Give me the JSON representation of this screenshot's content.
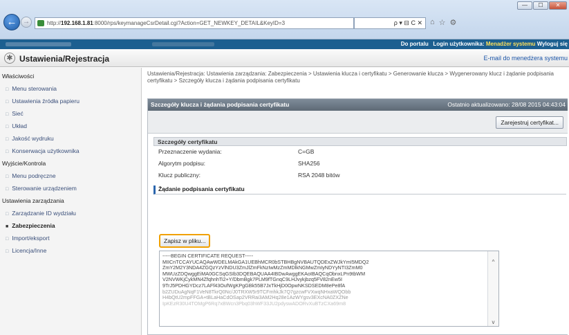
{
  "browser": {
    "address_prefix": "http://",
    "address_host": "192.168.1.81",
    "address_path": ":8000/rps/keymanageCsrDetail.cgi?Action=GET_NEWKEY_DETAIL&KeyID=3",
    "search_glyphs": "ρ ▾ ⊟ C ✕",
    "window_min": "—",
    "window_max": "☐",
    "window_close": "✕",
    "back_glyph": "←",
    "fwd_glyph": "→",
    "icons": [
      "home-icon",
      "star-icon",
      "gear-icon"
    ]
  },
  "portal": {
    "link_portal": "Do portalu",
    "login_user": "Login użytkownika:",
    "user_name": "Menadżer systemu",
    "logout": "Wyloguj się"
  },
  "header": {
    "title": "Ustawienia/Rejestracja",
    "mail_link": "E-mail do menedżera systemu"
  },
  "sidebar": {
    "section1": "Właściwości",
    "items1": [
      "Menu sterowania",
      "Ustawienia źródła papieru",
      "Sieć",
      "Układ",
      "Jakość wydruku",
      "Konserwacja użytkownika"
    ],
    "section2": "Wyjście/Kontrola",
    "items2": [
      "Menu podręczne",
      "Sterowanie urządzeniem"
    ],
    "section3": "Ustawienia zarządzania",
    "items3": [
      "Zarządzanie ID wydziału",
      "Zabezpieczenia",
      "Import/eksport",
      "Licencja/Inne"
    ],
    "active": "Zabezpieczenia"
  },
  "breadcrumb": "Ustawienia/Rejestracja: Ustawienia zarządzania: Zabezpieczenia > Ustawienia klucza i certyfikatu > Generowanie klucza > Wygenerowany klucz i żądanie podpisania certyfikatu > Szczegóły klucza i żądania podpisania certyfikatu",
  "panel": {
    "title": "Szczegóły klucza i żądania podpisania certyfikatu",
    "updated": "Ostatnio aktualizowano: 28/08 2015 04:43:04",
    "register_button": "Zarejestruj certyfikat..."
  },
  "details": {
    "section_title": "Szczegóły certyfikatu",
    "rows": [
      {
        "key": "Przeznaczenie wydania:",
        "value": "C=GB"
      },
      {
        "key": "Algorytm podpisu:",
        "value": "SHA256"
      },
      {
        "key": "Klucz publiczny:",
        "value": "RSA 2048 bitów"
      }
    ]
  },
  "csr": {
    "section_title": "Żądanie podpisania certyfikatu",
    "save_button": "Zapisz w pliku...",
    "lines": [
      "-----BEGIN CERTIFICATE REQUEST-----",
      "MIICnTCCAYUCAQAwWDELMAkGA1UEBhMCR0bSTBHBgNVBAUTQDExZWJkYmI5MDQ2",
      "ZmY2M2Y3NDA4ZGQzYzVlNDU3ZmJlZmFkNzIwMzZmMDlkNGMwZmIyNDYyNTI3ZmM0",
      "MWUzZDQwggEiMA0GCSqGSIb3DQEBAQUAA4IBDwAwggEKAoIBAQCqObnxLPn9tbWM",
      "V2NVWKjCykMN4ZfqhnhTi2+Y/DbmBgk7PLM9fTGnqC9LHJvykjbzq5FV82nEw5I",
      "9TrJ5PDHGYDcz7LAFf43OufWgKPgGBk55B7JxTkHjD0OpwNKSDSEDM8ePe8fA",
      "b2ZUDuAgNqF1VeN8TkrQ0Nc/J0TRXW5r9TCFmhkJk7Q7gzcwFVXwqNHxaWQObb",
      "H4bQtU2mpFFGA+tBLaHaCdOSap2VRRai3AM2Hq28e1AzWYgsv3EXcNA0ZXZNe",
      "IpKEzR30U4TOMgP6Rq7xBWcn3Pbq03hWF33JU2pdyswADORvXuBTzCXa69m8"
    ],
    "scroll_up": "^",
    "scroll_down": "v"
  }
}
